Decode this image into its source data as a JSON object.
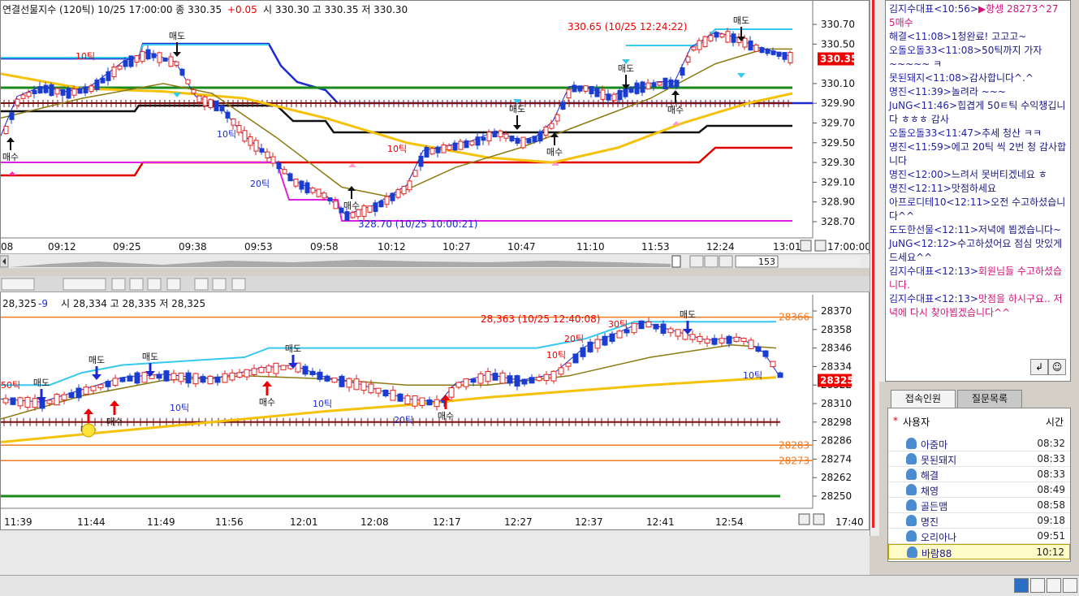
{
  "top_chart": {
    "header": "연결선물지수 (120틱) 10/25 17:00:00  종 330.35",
    "header_change": "+0.05",
    "header_tail": "시 330.30 고 330.35 저 330.30",
    "price_badge": "330.35",
    "y_ticks": [
      "330.70",
      "330.50",
      "330.10",
      "329.90",
      "329.70",
      "329.50",
      "329.30",
      "329.10",
      "328.90",
      "328.70"
    ],
    "x_ticks": [
      "08",
      "09:12",
      "09:25",
      "09:38",
      "09:53",
      "09:58",
      "10:12",
      "10:27",
      "10:47",
      "11:10",
      "11:53",
      "12:24",
      "13:01",
      "17:00:00"
    ],
    "high_label": "330.65 (10/25 12:24:22)",
    "low_label": "328.70 (10/25 10:00:21)",
    "zoom_value": "153",
    "annotations": {
      "sell": "매도",
      "buy": "매수",
      "tick10": "10틱",
      "tick20": "20틱"
    }
  },
  "bottom_chart": {
    "header_value": "28,325",
    "header_change": "-9",
    "header_tail": "시 28,334 고 28,335 저 28,325",
    "price_badge": "28325",
    "y_ticks": [
      "28370",
      "28358",
      "28346",
      "28334",
      "28322",
      "28310",
      "28298",
      "28286",
      "28274",
      "28262",
      "28250"
    ],
    "level_badges": [
      "28366",
      "28283",
      "28273"
    ],
    "x_ticks": [
      "11:39",
      "11:44",
      "11:49",
      "11:56",
      "12:01",
      "12:08",
      "12:17",
      "12:27",
      "12:37",
      "12:41",
      "12:54",
      "17:40"
    ],
    "high_label": "28,363 (10/25 12:40:08)",
    "annotations": {
      "sell": "매도",
      "buy": "매수",
      "tick10": "10틱",
      "tick20": "20틱",
      "tick30": "30틱",
      "tick50": "50틱"
    }
  },
  "chat": {
    "messages": [
      {
        "who": "김지수대표<10:56>",
        "text": "▶항셍 28273^27",
        "pink": true
      },
      {
        "who": "",
        "text": "5매수",
        "pink": true
      },
      {
        "who": "해결<11:08>",
        "text": "1청완료! 고고고~"
      },
      {
        "who": "오돌오돌33<11:08>",
        "text": "50틱까지 가자~~~~~ ㅋ"
      },
      {
        "who": "못된돼지<11:08>",
        "text": "감사합니다^.^"
      },
      {
        "who": "명진<11:39>",
        "text": "놀려라 ~~~"
      },
      {
        "who": "JuNG<11:46>",
        "text": "힙겹게 50ㅌ틱 수익챙깁니다 ㅎㅎㅎ 감사"
      },
      {
        "who": "오돌오돌33<11:47>",
        "text": "추세 청산 ㅋㅋ"
      },
      {
        "who": "명진<11:59>",
        "text": "에고 20틱 씩 2번 청 감사합니다"
      },
      {
        "who": "명진<12:00>",
        "text": "느려서 못버티겠네요 ㅎ"
      },
      {
        "who": "명진<12:11>",
        "text": "맛점하세요"
      },
      {
        "who": "아프로디테10<12:11>",
        "text": "오전 수고하셨습니다^^"
      },
      {
        "who": "도도한선물<12:11>",
        "text": "저녁에 뵙겠습니다~"
      },
      {
        "who": "JuNG<12:12>",
        "text": "수고하셨어요 점심 맛있게드세요^^"
      },
      {
        "who": "김지수대표<12:13>",
        "text": "회원님들 수고하셨습니다.",
        "pink": true
      },
      {
        "who": "김지수대표<12:13>",
        "text": "맛점을 하시구요.. 저녁에 다시 찾아뵙겠습니다^^",
        "pink": true
      }
    ]
  },
  "tabs": [
    "접속인원",
    "질문목록"
  ],
  "user_list": {
    "col_user": "사용자",
    "col_time": "시간",
    "rows": [
      {
        "name": "아줌마",
        "time": "08:32"
      },
      {
        "name": "못된돼지",
        "time": "08:33"
      },
      {
        "name": "해결",
        "time": "08:33"
      },
      {
        "name": "채영",
        "time": "08:49"
      },
      {
        "name": "골든맴",
        "time": "08:58"
      },
      {
        "name": "명진",
        "time": "09:18"
      },
      {
        "name": "오리아나",
        "time": "09:51"
      },
      {
        "name": "바람88",
        "time": "10:12"
      }
    ]
  },
  "colors": {
    "up_candle": "#e62020",
    "down_candle": "#1a3ccf",
    "cyan": "#37c8f0",
    "yellow": "#f5c20a",
    "green": "#1a8a1a",
    "magenta": "#e020e0",
    "red_line": "#e00000",
    "orange": "#f07a20",
    "olive": "#8a7a10",
    "dark_red": "#7a1010"
  }
}
